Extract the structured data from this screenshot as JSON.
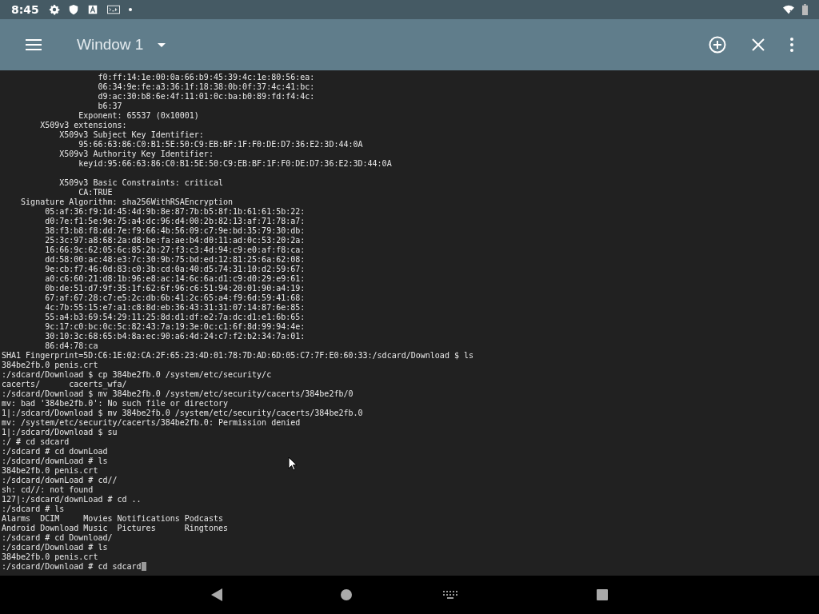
{
  "status_bar": {
    "time": "8:45"
  },
  "toolbar": {
    "title": "Window 1"
  },
  "terminal": {
    "sections": [
      {
        "lines": [
          "                    f0:ff:14:1e:00:0a:66:b9:45:39:4c:1e:80:56:ea:",
          "                    06:34:9e:fe:a3:36:1f:18:38:0b:0f:37:4c:41:bc:",
          "                    d9:ac:30:b8:6e:4f:11:01:0c:ba:b0:89:fd:f4:4c:",
          "                    b6:37",
          "                Exponent: 65537 (0x10001)",
          "        X509v3 extensions:",
          "            X509v3 Subject Key Identifier:",
          "                95:66:63:86:C0:B1:5E:50:C9:EB:BF:1F:F0:DE:D7:36:E2:3D:44:0A",
          "            X509v3 Authority Key Identifier:",
          "                keyid:95:66:63:86:C0:B1:5E:50:C9:EB:BF:1F:F0:DE:D7:36:E2:3D:44:0A"
        ]
      },
      {
        "lines": [
          "            X509v3 Basic Constraints: critical",
          "                CA:TRUE",
          "    Signature Algorithm: sha256WithRSAEncryption",
          "         05:af:36:f9:1d:45:4d:9b:8e:87:7b:b5:8f:1b:61:61:5b:22:",
          "         d0:7e:f1:5e:9e:75:a4:dc:96:d4:00:2b:82:13:af:71:78:a7:",
          "         38:f3:b8:f8:dd:7e:f9:66:4b:56:09:c7:9e:bd:35:79:30:db:",
          "         25:3c:97:a8:68:2a:d8:be:fa:ae:b4:d0:11:ad:0c:53:20:2a:",
          "         16:66:9c:62:05:6c:85:2b:27:f3:c3:4d:94:c9:e0:af:f8:ca:",
          "         dd:58:00:ac:48:e3:7c:30:9b:75:bd:ed:12:81:25:6a:62:08:",
          "         9e:cb:f7:46:0d:83:c0:3b:cd:0a:40:d5:74:31:10:d2:59:67:",
          "         a0:c6:60:21:d8:1b:96:e8:ac:14:6c:6a:d1:c9:d0:29:e9:61:",
          "         0b:de:51:d7:9f:35:1f:62:6f:96:c6:51:94:20:01:90:a4:19:",
          "         67:af:67:28:c7:e5:2c:db:6b:41:2c:65:a4:f9:6d:59:41:68:",
          "         4c:7b:55:15:e7:a1:c8:8d:eb:36:43:31:31:07:14:87:6e:85:",
          "         55:a4:b3:69:54:29:11:25:8d:d1:df:e2:7a:dc:d1:e1:6b:65:",
          "         9c:17:c0:bc:0c:5c:82:43:7a:19:3e:0c:c1:6f:8d:99:94:4e:",
          "         30:10:3c:68:65:b4:8a:ec:90:a6:4d:24:c7:f2:b2:34:7a:01:",
          "         86:d4:78:ca",
          "SHA1 Fingerprint=5D:C6:1E:02:CA:2F:65:23:4D:01:78:7D:AD:6D:05:C7:7F:E0:60:33:/sdcard/Download $ ls",
          "384be2fb.0 penis.crt",
          ":/sdcard/Download $ cp 384be2fb.0 /system/etc/security/c",
          "cacerts/      cacerts_wfa/",
          ":/sdcard/Download $ mv 384be2fb.0 /system/etc/security/cacerts/384be2fb/0",
          "mv: bad '384be2fb.0': No such file or directory",
          "1|:/sdcard/Download $ mv 384be2fb.0 /system/etc/security/cacerts/384be2fb.0",
          "mv: /system/etc/security/cacerts/384be2fb.0: Permission denied",
          "1|:/sdcard/Download $ su",
          ":/ # cd sdcard",
          ":/sdcard # cd downLoad",
          ":/sdcard/downLoad # ls",
          "384be2fb.0 penis.crt",
          ":/sdcard/downLoad # cd//",
          "sh: cd//: not found",
          "127|:/sdcard/downLoad # cd ..",
          ":/sdcard # ls",
          "Alarms  DCIM     Movies Notifications Podcasts",
          "Android Download Music  Pictures      Ringtones",
          ":/sdcard # cd Download/",
          ":/sdcard/Download # ls",
          "384be2fb.0 penis.crt",
          ":/sdcard/Download # cd sdcard"
        ]
      }
    ]
  }
}
